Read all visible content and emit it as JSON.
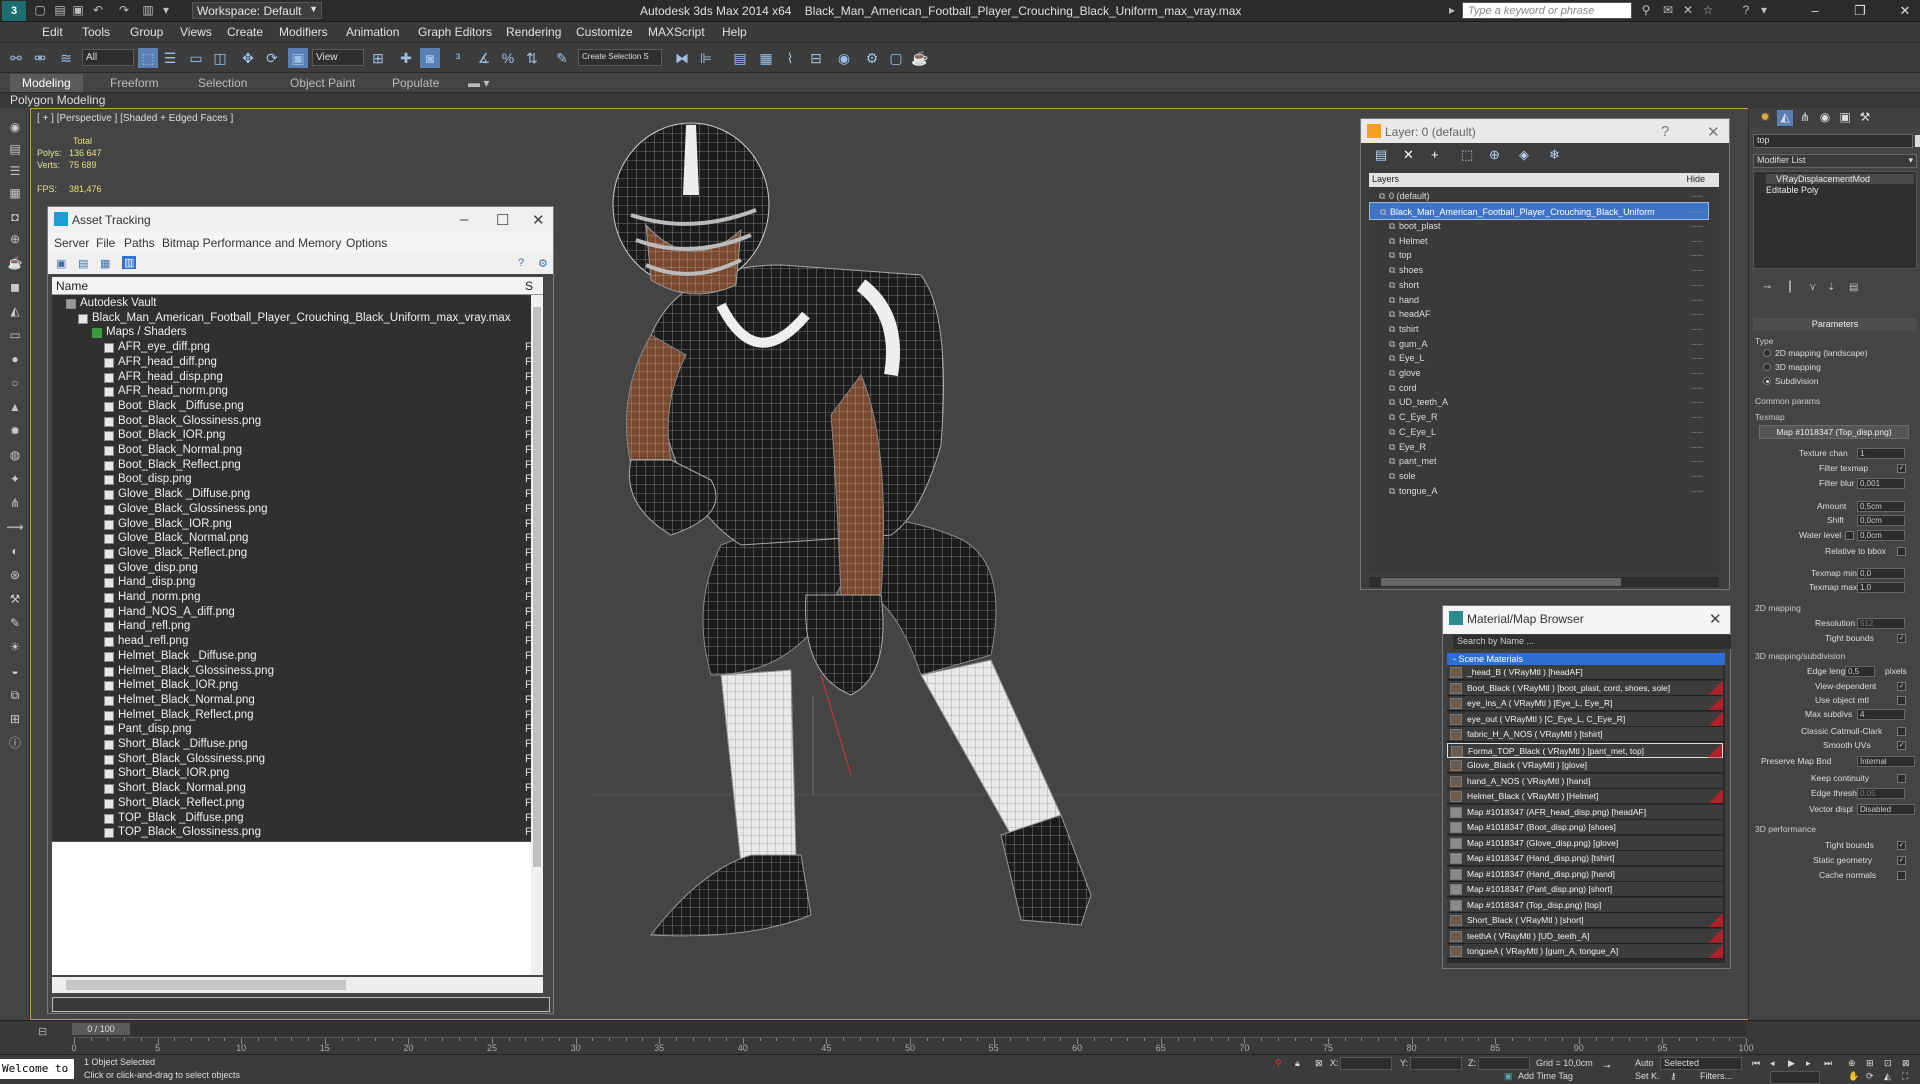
{
  "titlebar": {
    "app_title": "Autodesk 3ds Max  2014 x64",
    "file_name": "Black_Man_American_Football_Player_Crouching_Black_Uniform_max_vray.max",
    "workspace": "Workspace: Default",
    "search_placeholder": "Type a keyword or phrase"
  },
  "menu": [
    "Edit",
    "Tools",
    "Group",
    "Views",
    "Create",
    "Modifiers",
    "Animation",
    "Graph Editors",
    "Rendering",
    "Customize",
    "MAXScript",
    "Help"
  ],
  "toolbar": {
    "selection_filter": "All",
    "ref_coord": "View",
    "named_selection": "Create Selection S"
  },
  "ribbon": {
    "tabs": [
      "Modeling",
      "Freeform",
      "Selection",
      "Object Paint",
      "Populate"
    ],
    "active": "Modeling",
    "panel": "Polygon Modeling"
  },
  "viewport": {
    "label": "[ + ] [Perspective ] [Shaded + Edged Faces ]",
    "stats_total": "Total",
    "polys_label": "Polys:",
    "polys": "136 647",
    "verts_label": "Verts:",
    "verts": "75 689",
    "fps_label": "FPS:",
    "fps": "381,476"
  },
  "asset_tracking": {
    "title": "Asset Tracking",
    "menu": [
      "Server",
      "File",
      "Paths",
      "Bitmap Performance and Memory",
      "Options"
    ],
    "col_name": "Name",
    "col_status": "S",
    "root": "Autodesk Vault",
    "file": "Black_Man_American_Football_Player_Crouching_Black_Uniform_max_vray.max",
    "group": "Maps / Shaders",
    "files": [
      "AFR_eye_diff.png",
      "AFR_head_diff.png",
      "AFR_head_disp.png",
      "AFR_head_norm.png",
      "Boot_Black _Diffuse.png",
      "Boot_Black_Glossiness.png",
      "Boot_Black_IOR.png",
      "Boot_Black_Normal.png",
      "Boot_Black_Reflect.png",
      "Boot_disp.png",
      "Glove_Black _Diffuse.png",
      "Glove_Black_Glossiness.png",
      "Glove_Black_IOR.png",
      "Glove_Black_Normal.png",
      "Glove_Black_Reflect.png",
      "Glove_disp.png",
      "Hand_disp.png",
      "Hand_norm.png",
      "Hand_NOS_A_diff.png",
      "Hand_refl.png",
      "head_refl.png",
      "Helmet_Black _Diffuse.png",
      "Helmet_Black_Glossiness.png",
      "Helmet_Black_IOR.png",
      "Helmet_Black_Normal.png",
      "Helmet_Black_Reflect.png",
      "Pant_disp.png",
      "Short_Black _Diffuse.png",
      "Short_Black_Glossiness.png",
      "Short_Black_IOR.png",
      "Short_Black_Normal.png",
      "Short_Black_Reflect.png",
      "TOP_Black _Diffuse.png",
      "TOP_Black_Glossiness.png"
    ],
    "status_char": "F"
  },
  "layer_window": {
    "title": "Layer: 0 (default)",
    "col_layers": "Layers",
    "col_hide": "Hide",
    "default_layer": "0 (default)",
    "selected_layer": "Black_Man_American_Football_Player_Crouching_Black_Uniform",
    "objects": [
      "boot_plast",
      "Helmet",
      "top",
      "shoes",
      "short",
      "hand",
      "headAF",
      "tshirt",
      "gum_A",
      "Eye_L",
      "glove",
      "cord",
      "UD_teeth_A",
      "C_Eye_R",
      "C_Eye_L",
      "Eye_R",
      "pant_met",
      "sole",
      "tongue_A"
    ]
  },
  "material_browser": {
    "title": "Material/Map Browser",
    "search_placeholder": "Search by Name ...",
    "section": "- Scene Materials",
    "materials": [
      {
        "label": "_head_B  ( VRayMtl ) [headAF]",
        "red": false
      },
      {
        "label": "Boot_Black  ( VRayMtl ) [boot_plast, cord, shoes, sole]",
        "red": true
      },
      {
        "label": "eye_ins_A  ( VRayMtl ) [Eye_L, Eye_R]",
        "red": true
      },
      {
        "label": "eye_out  ( VRayMtl ) [C_Eye_L, C_Eye_R]",
        "red": true
      },
      {
        "label": "fabric_H_A_NOS  ( VRayMtl ) [tshirt]",
        "red": false
      },
      {
        "label": "Forma_TOP_Black  ( VRayMtl ) [pant_met, top]",
        "red": true
      },
      {
        "label": "Glove_Black  ( VRayMtl ) [glove]",
        "red": false
      },
      {
        "label": "hand_A_NOS  ( VRayMtl ) [hand]",
        "red": false
      },
      {
        "label": "Helmet_Black  ( VRayMtl ) [Helmet]",
        "red": true
      },
      {
        "label": "Map #1018347 (AFR_head_disp.png) [headAF]",
        "red": false
      },
      {
        "label": "Map #1018347 (Boot_disp.png) [shoes]",
        "red": false
      },
      {
        "label": "Map #1018347 (Glove_disp.png) [glove]",
        "red": false
      },
      {
        "label": "Map #1018347 (Hand_disp.png) [tshirt]",
        "red": false
      },
      {
        "label": "Map #1018347 (Hand_disp.png) [hand]",
        "red": false
      },
      {
        "label": "Map #1018347 (Pant_disp.png) [short]",
        "red": false
      },
      {
        "label": "Map #1018347 (Top_disp.png) [top]",
        "red": false
      },
      {
        "label": "Short_Black  ( VRayMtl ) [short]",
        "red": true
      },
      {
        "label": "teethA  ( VRayMtl ) [UD_teeth_A]",
        "red": true
      },
      {
        "label": "tongueA  ( VRayMtl ) [gum_A, tongue_A]",
        "red": true
      }
    ]
  },
  "command_panel": {
    "object_name": "top",
    "modifier_list": "Modifier List",
    "stack": [
      "VRayDisplacementMod",
      "Editable Poly"
    ],
    "params_title": "Parameters",
    "type_label": "Type",
    "type_options": [
      "2D mapping (landscape)",
      "3D mapping",
      "Subdivision"
    ],
    "common_params": "Common params",
    "texmap_label": "Texmap",
    "texmap": "Map #1018347 (Top_disp.png)",
    "texture_chan_label": "Texture chan",
    "texture_chan": "1",
    "filter_texmap_label": "Filter texmap",
    "filter_blur_label": "Filter blur",
    "filter_blur": "0,001",
    "amount_label": "Amount",
    "amount": "0,5cm",
    "shift_label": "Shift",
    "shift": "0,0cm",
    "water_level_label": "Water level",
    "water_level": "0,0cm",
    "relative_bbox": "Relative to bbox",
    "texmap_min_label": "Texmap min",
    "texmap_min": "0,0",
    "texmap_max_label": "Texmap max",
    "texmap_max": "1,0",
    "d2_section": "2D mapping",
    "resolution_label": "Resolution",
    "resolution": "512",
    "tight_bounds": "Tight bounds",
    "d3_section": "3D mapping/subdivision",
    "edge_length_label": "Edge length",
    "edge_length": "0,5",
    "pixels": "pixels",
    "view_dependent": "View-dependent",
    "use_object_mtl": "Use object mtl",
    "max_subdivs_label": "Max subdivs",
    "max_subdivs": "4",
    "classic_catmull": "Classic Catmull-Clark",
    "smooth_uvs": "Smooth UVs",
    "preserve_map_label": "Preserve Map Bnd",
    "preserve_map": "Internal",
    "keep_continuity": "Keep continuity",
    "edge_thresh_label": "Edge thresh",
    "edge_thresh": "0,05",
    "vector_displ_label": "Vector displ",
    "vector_displ": "Disabled",
    "perf_section": "3D performance",
    "static_geometry": "Static geometry",
    "cache_normals": "Cache normals"
  },
  "timeline": {
    "frame": "0 / 100",
    "ticks": [
      "0",
      "5",
      "10",
      "15",
      "20",
      "25",
      "30",
      "35",
      "40",
      "45",
      "50",
      "55",
      "60",
      "65",
      "70",
      "75",
      "80",
      "85",
      "90",
      "95",
      "100"
    ]
  },
  "status": {
    "welcome": "Welcome to",
    "selected": "1 Object Selected",
    "prompt": "Click or click-and-drag to select objects",
    "x_label": "X:",
    "y_label": "Y:",
    "z_label": "Z:",
    "grid": "Grid = 10,0cm",
    "add_time_tag": "Add Time Tag",
    "auto": "Auto",
    "set_k": "Set K.",
    "selected_mode": "Selected",
    "filters": "Filters..."
  },
  "colors": {
    "viewport_border": "#c9a13c",
    "selection_blue": "#3f73c8",
    "material_red": "#b3202a"
  }
}
